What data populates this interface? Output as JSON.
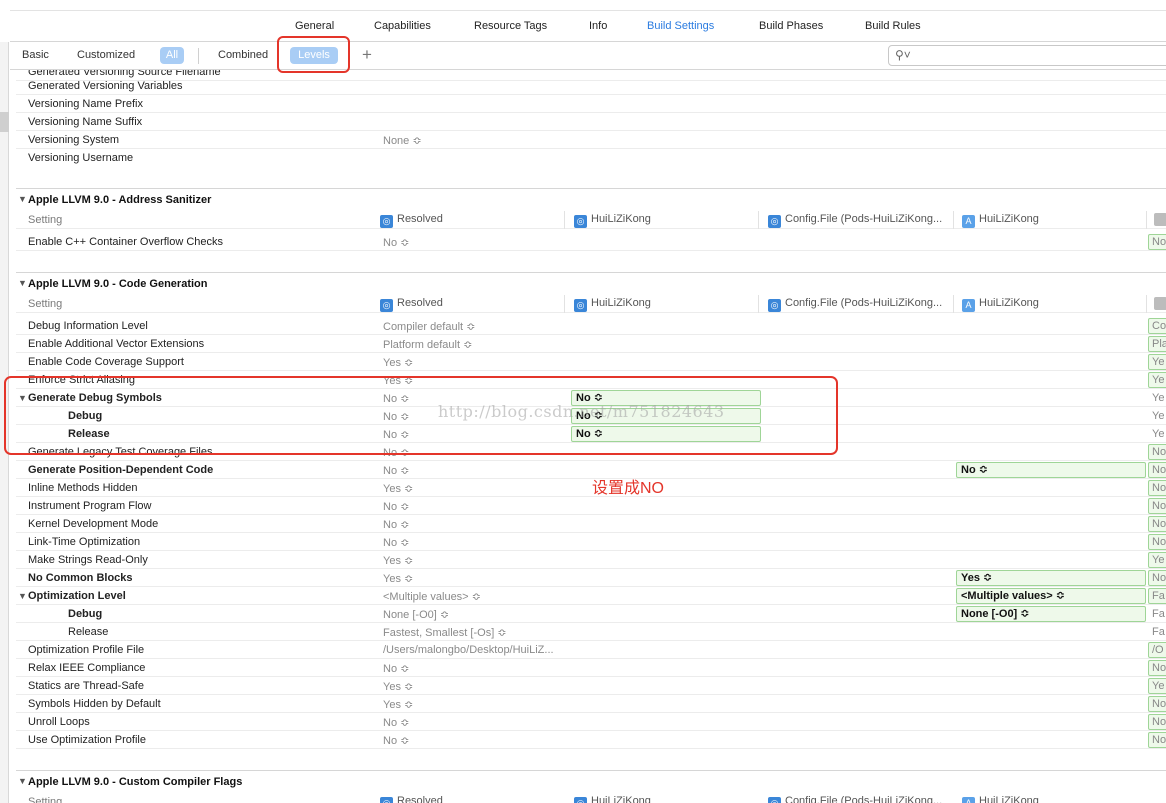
{
  "top_tabs": [
    "General",
    "Capabilities",
    "Resource Tags",
    "Info",
    "Build Settings",
    "Build Phases",
    "Build Rules"
  ],
  "filters": {
    "basic": "Basic",
    "customized": "Customized",
    "all": "All",
    "combined": "Combined",
    "levels": "Levels",
    "add": "+",
    "search_placeholder": ""
  },
  "annotation": "设置成NO",
  "watermark": "http://blog.csdn.net/m751824643",
  "col_headers": {
    "setting": "Setting",
    "resolved": "Resolved",
    "target": "HuiLiZiKong",
    "config_file": "Config.File (Pods-HuiLiZiKong...",
    "project": "HuiLiZiKong"
  },
  "versioning": {
    "partial_row": "Generated Versioning Source Filename",
    "rows": [
      {
        "name": "Generated Versioning Variables",
        "resolved": ""
      },
      {
        "name": "Versioning Name Prefix",
        "resolved": ""
      },
      {
        "name": "Versioning Name Suffix",
        "resolved": ""
      },
      {
        "name": "Versioning System",
        "resolved": "None ≎"
      },
      {
        "name": "Versioning Username",
        "resolved": ""
      }
    ]
  },
  "address_sanitizer": {
    "title": "Apple LLVM 9.0 - Address Sanitizer",
    "rows": [
      {
        "name": "Enable C++ Container Overflow Checks",
        "resolved": "No ≎",
        "edge": "No"
      }
    ]
  },
  "code_generation": {
    "title": "Apple LLVM 9.0 - Code Generation",
    "rows": [
      {
        "name": "Debug Information Level",
        "resolved": "Compiler default ≎",
        "edge": "Co"
      },
      {
        "name": "Enable Additional Vector Extensions",
        "resolved": "Platform default ≎",
        "edge": "Pla"
      },
      {
        "name": "Enable Code Coverage Support",
        "resolved": "Yes ≎",
        "edge": "Ye"
      },
      {
        "name": "Enforce Strict Aliasing",
        "resolved": "Yes ≎",
        "edge": "Ye"
      },
      {
        "name": "Generate Debug Symbols",
        "resolved": "No ≎",
        "target": "No ≎",
        "edge": "Ye"
      },
      {
        "name": "Debug",
        "resolved": "No ≎",
        "target": "No ≎",
        "edge": "Ye"
      },
      {
        "name": "Release",
        "resolved": "No ≎",
        "target": "No ≎",
        "edge": "Ye"
      },
      {
        "name": "Generate Legacy Test Coverage Files",
        "resolved": "No ≎",
        "edge": "No"
      },
      {
        "name": "Generate Position-Dependent Code",
        "resolved": "No ≎",
        "project": "No ≎",
        "edge": "No"
      },
      {
        "name": "Inline Methods Hidden",
        "resolved": "Yes ≎",
        "edge": "No"
      },
      {
        "name": "Instrument Program Flow",
        "resolved": "No ≎",
        "edge": "No"
      },
      {
        "name": "Kernel Development Mode",
        "resolved": "No ≎",
        "edge": "No"
      },
      {
        "name": "Link-Time Optimization",
        "resolved": "No ≎",
        "edge": "No"
      },
      {
        "name": "Make Strings Read-Only",
        "resolved": "Yes ≎",
        "edge": "Ye"
      },
      {
        "name": "No Common Blocks",
        "resolved": "Yes ≎",
        "project": "Yes ≎",
        "edge": "No"
      },
      {
        "name": "Optimization Level",
        "resolved": "<Multiple values> ≎",
        "project": "<Multiple values> ≎",
        "edge": "Fa"
      },
      {
        "name": "Debug",
        "resolved": "None [-O0] ≎",
        "project": "None [-O0] ≎",
        "edge": "Fa"
      },
      {
        "name": "Release",
        "resolved": "Fastest, Smallest [-Os] ≎",
        "edge": "Fa"
      },
      {
        "name": "Optimization Profile File",
        "resolved": "/Users/malongbo/Desktop/HuiLiZ...",
        "edge": "/O"
      },
      {
        "name": "Relax IEEE Compliance",
        "resolved": "No ≎",
        "edge": "No"
      },
      {
        "name": "Statics are Thread-Safe",
        "resolved": "Yes ≎",
        "edge": "Ye"
      },
      {
        "name": "Symbols Hidden by Default",
        "resolved": "Yes ≎",
        "edge": "No"
      },
      {
        "name": "Unroll Loops",
        "resolved": "No ≎",
        "edge": "No"
      },
      {
        "name": "Use Optimization Profile",
        "resolved": "No ≎",
        "edge": "No"
      }
    ]
  },
  "custom_flags": {
    "title": "Apple LLVM 9.0 - Custom Compiler Flags"
  },
  "colors": {
    "accent": "#2a7be0",
    "highlight_red": "#e4352a",
    "cell_green_bg": "#eef9ea",
    "cell_green_border": "#9fd597"
  }
}
